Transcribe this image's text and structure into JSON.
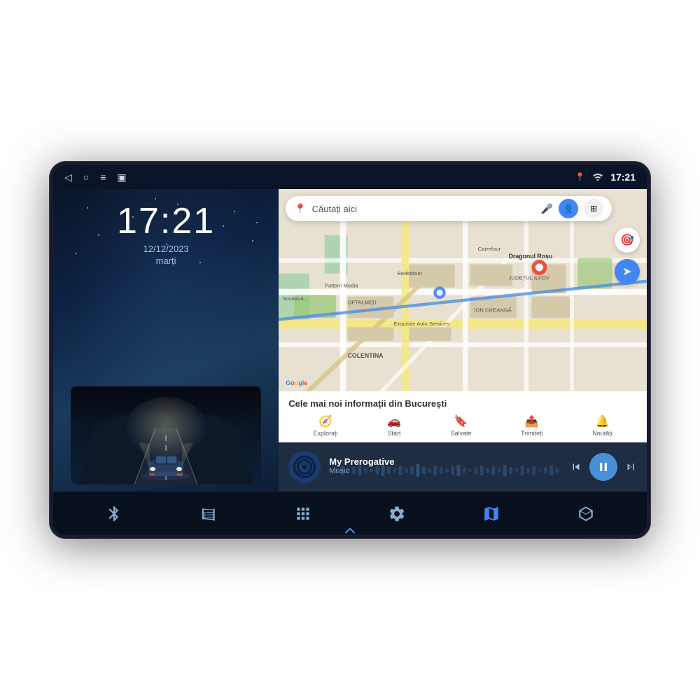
{
  "device": {
    "status_bar": {
      "time": "17:21",
      "nav_back": "◁",
      "nav_home": "○",
      "nav_menu": "≡",
      "nav_app": "▣",
      "icon_pin": "⊕",
      "icon_wifi": "wifi",
      "icon_signal": "signal"
    },
    "left_panel": {
      "clock": "17:21",
      "date": "12/12/2023",
      "day": "marți"
    },
    "right_panel": {
      "map": {
        "search_placeholder": "Căutați aici",
        "info_title": "Cele mai noi informații din București",
        "nav_tabs": [
          {
            "icon": "🧭",
            "label": "Explorați"
          },
          {
            "icon": "🚗",
            "label": "Start"
          },
          {
            "icon": "🔖",
            "label": "Salvate"
          },
          {
            "icon": "📤",
            "label": "Trimiteți"
          },
          {
            "icon": "🔔",
            "label": "Noutăți"
          }
        ],
        "map_labels": [
          "Carrefour",
          "Dragonul Roșu",
          "Pattern Media",
          "OFTALMED",
          "Exquisite Auto Services",
          "ION CREANGĂ",
          "JUDEȚUL ILFOV",
          "COLENTINA",
          "Bededmar"
        ]
      },
      "music": {
        "title": "My Prerogative",
        "subtitle": "Music",
        "ctrl_prev": "⏮",
        "ctrl_play": "⏸",
        "ctrl_next": "⏭"
      }
    },
    "bottom_nav": {
      "items": [
        {
          "icon": "bluetooth",
          "label": "Bluetooth"
        },
        {
          "icon": "radio",
          "label": "Radio"
        },
        {
          "icon": "apps",
          "label": "Apps"
        },
        {
          "icon": "settings",
          "label": "Settings"
        },
        {
          "icon": "maps",
          "label": "Maps"
        },
        {
          "icon": "cube",
          "label": "3D"
        }
      ]
    }
  }
}
